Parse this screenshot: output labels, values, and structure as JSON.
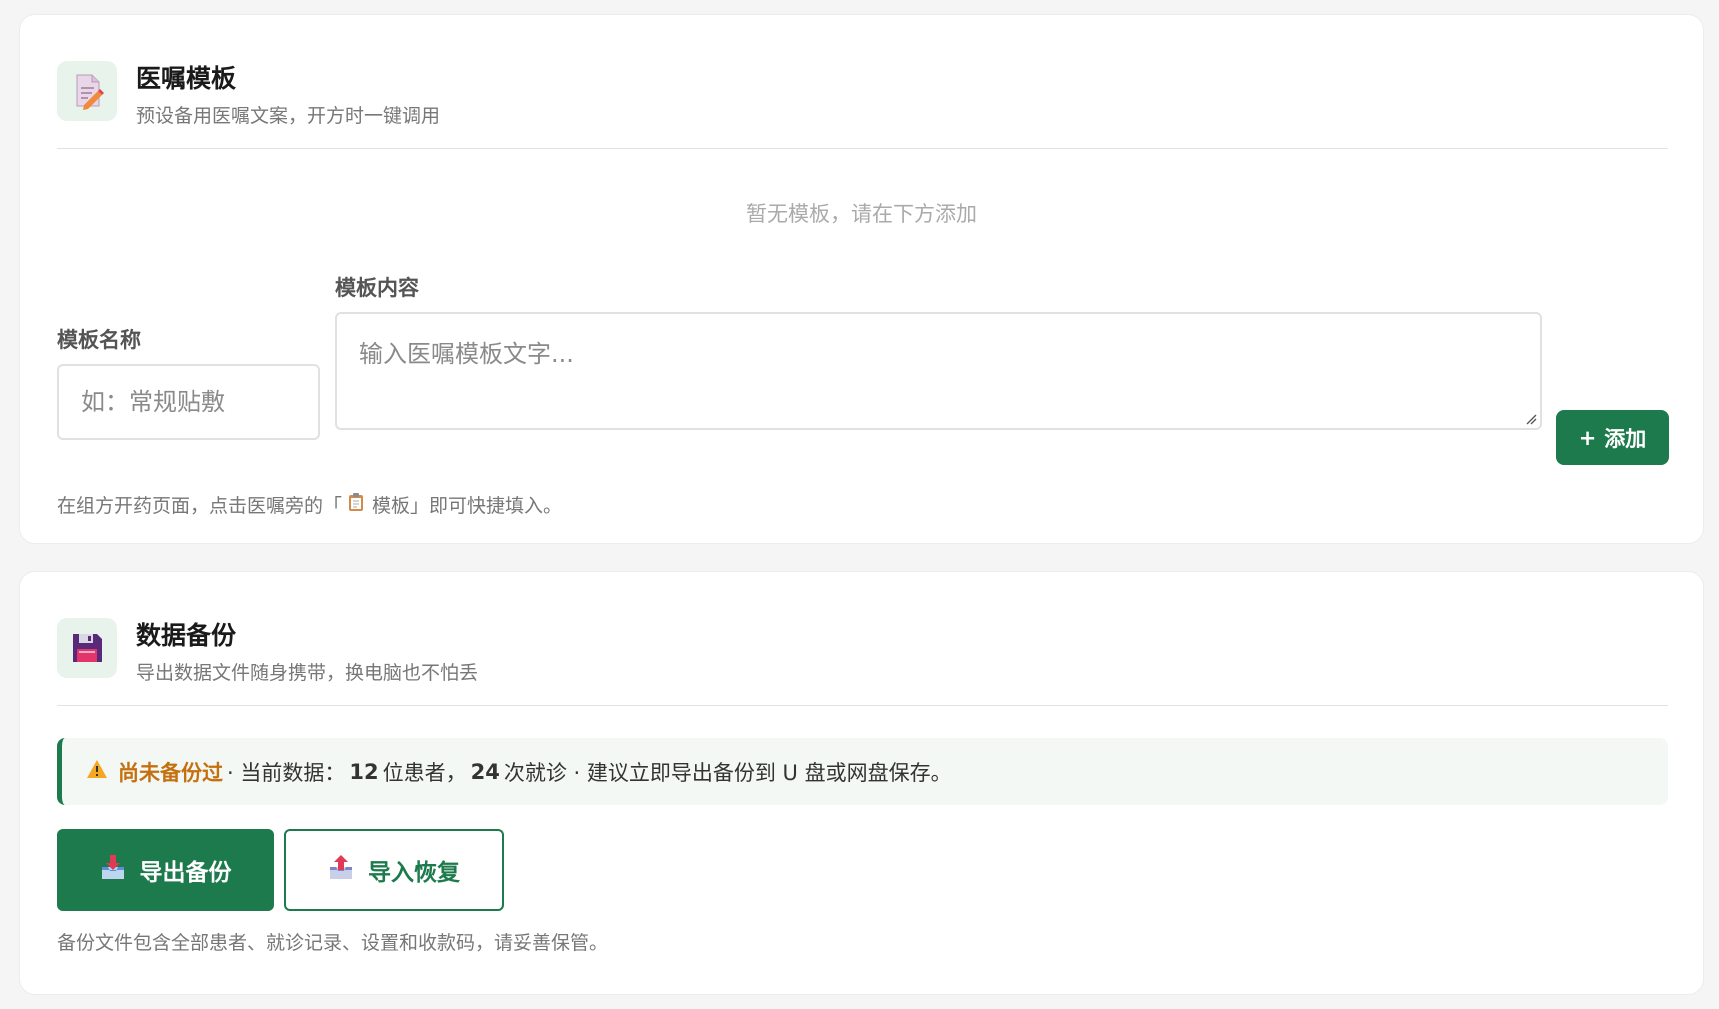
{
  "colors": {
    "primary": "#1c7a4c",
    "warning": "#c5700e",
    "background": "#f5f5f5",
    "icon_bg": "#e8f3ec"
  },
  "template_card": {
    "icon": "memo-pencil-icon",
    "title": "医嘱模板",
    "subtitle": "预设备用医嘱文案，开方时一键调用",
    "empty_hint": "暂无模板，请在下方添加",
    "name_label": "模板名称",
    "name_placeholder": "如：常规贴敷",
    "name_value": "",
    "content_label": "模板内容",
    "content_placeholder": "输入医嘱模板文字...",
    "content_value": "",
    "add_button": {
      "icon": "plus",
      "symbol": "+",
      "label": "添加"
    },
    "helper": {
      "before": "在组方开药页面，点击医嘱旁的「",
      "icon": "clipboard-icon",
      "label": "模板",
      "after": "」即可快捷填入。"
    }
  },
  "backup_card": {
    "icon": "floppy-disk-icon",
    "title": "数据备份",
    "subtitle": "导出数据文件随身携带，换电脑也不怕丢",
    "alert": {
      "icon": "warning-triangle-icon",
      "status": "尚未备份过",
      "text1": "· 当前数据：",
      "patients_count": "12",
      "text2": "位患者，",
      "visits_count": "24",
      "text3": "次就诊 · 建议立即导出备份到 U 盘或网盘保存。"
    },
    "export_button": {
      "icon": "outbox-tray-icon",
      "label": "导出备份"
    },
    "import_button": {
      "icon": "inbox-tray-icon",
      "label": "导入恢复"
    },
    "helper": "备份文件包含全部患者、就诊记录、设置和收款码，请妥善保管。"
  }
}
